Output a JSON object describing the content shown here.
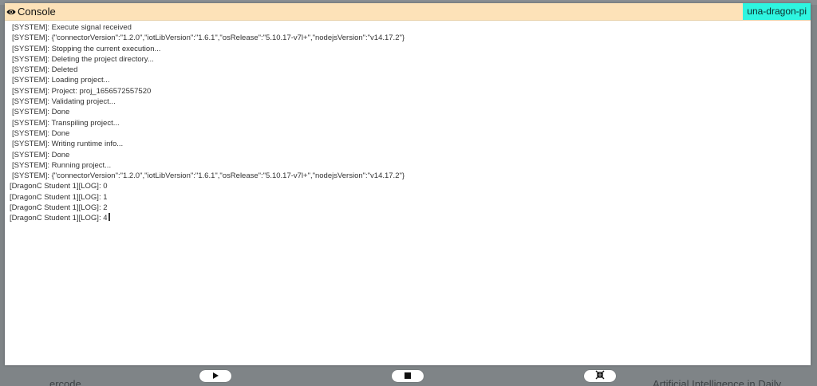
{
  "console": {
    "title": "Console",
    "device_name": "una-dragon-pi",
    "lines": [
      {
        "kind": "system",
        "text": "[SYSTEM]: Execute signal received"
      },
      {
        "kind": "system",
        "text": "[SYSTEM]: {\"connectorVersion\":\"1.2.0\",\"iotLibVersion\":\"1.6.1\",\"osRelease\":\"5.10.17-v7l+\",\"nodejsVersion\":\"v14.17.2\"}"
      },
      {
        "kind": "system",
        "text": "[SYSTEM]: Stopping the current execution..."
      },
      {
        "kind": "system",
        "text": "[SYSTEM]: Deleting the project directory..."
      },
      {
        "kind": "system",
        "text": "[SYSTEM]: Deleted"
      },
      {
        "kind": "system",
        "text": "[SYSTEM]: Loading project..."
      },
      {
        "kind": "system",
        "text": "[SYSTEM]: Project: proj_1656572557520"
      },
      {
        "kind": "system",
        "text": "[SYSTEM]: Validating project..."
      },
      {
        "kind": "system",
        "text": "[SYSTEM]: Done"
      },
      {
        "kind": "system",
        "text": "[SYSTEM]: Transpiling project..."
      },
      {
        "kind": "system",
        "text": "[SYSTEM]: Done"
      },
      {
        "kind": "system",
        "text": "[SYSTEM]: Writing runtime info..."
      },
      {
        "kind": "system",
        "text": "[SYSTEM]: Done"
      },
      {
        "kind": "system",
        "text": "[SYSTEM]: Running project..."
      },
      {
        "kind": "system",
        "text": "[SYSTEM]: {\"connectorVersion\":\"1.2.0\",\"iotLibVersion\":\"1.6.1\",\"osRelease\":\"5.10.17-v7l+\",\"nodejsVersion\":\"v14.17.2\"}"
      },
      {
        "kind": "log",
        "text": "[DragonC Student 1][LOG]: 0"
      },
      {
        "kind": "log",
        "text": "[DragonC Student 1][LOG]: 1"
      },
      {
        "kind": "log",
        "text": "[DragonC Student 1][LOG]: 2"
      },
      {
        "kind": "log",
        "text": "[DragonC Student 1][LOG]: 4"
      }
    ]
  },
  "controls": {
    "play": {
      "icon": "play-icon"
    },
    "stop": {
      "icon": "stop-icon"
    },
    "collapse": {
      "icon": "collapse-icon"
    }
  },
  "background": {
    "bottom_left": "ercode",
    "bottom_right": "Artificial Intelligence in Daily"
  },
  "colors": {
    "header_bg": "#fde2b8",
    "badge_bg": "#2ef5e0",
    "backdrop": "#7f8487"
  }
}
